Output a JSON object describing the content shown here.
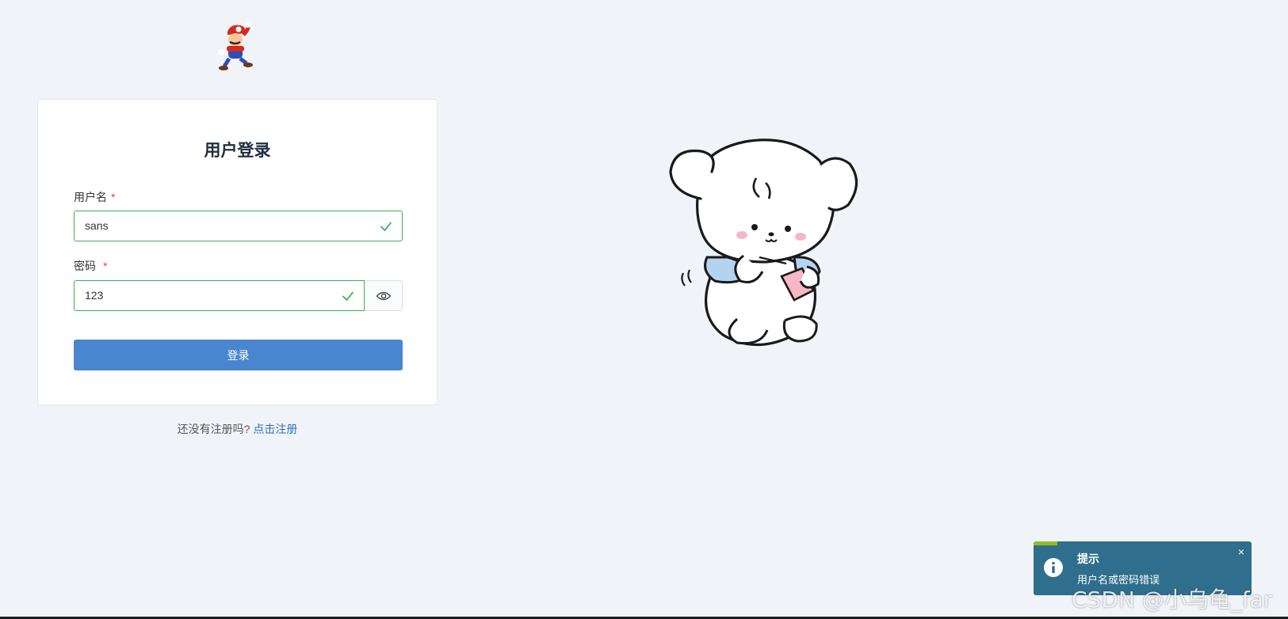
{
  "login": {
    "title": "用户登录",
    "username_label": "用户名",
    "username_required": "*",
    "username_value": "sans",
    "password_label": "密码",
    "password_required": "*",
    "password_value": "123",
    "submit_label": "登录"
  },
  "register": {
    "prompt": "还没有注册吗?",
    "link_label": "点击注册"
  },
  "notification": {
    "title": "提示",
    "message": "用户名或密码错误",
    "close_glyph": "×"
  },
  "watermark": "CSDN @小乌龟_far",
  "colors": {
    "background": "#f0f3f8",
    "valid": "#3cb054",
    "primary": "#4a86d0",
    "required": "#e0453a",
    "link": "#2f6fc2",
    "toast": "#2f6f8d",
    "toast_progress": "#8fbe1f"
  },
  "icons": {
    "logo": "mario-logo",
    "username_status": "check-icon",
    "password_status": "check-icon",
    "password_toggle": "eye-icon",
    "notification": "info-icon",
    "close": "close-icon"
  }
}
